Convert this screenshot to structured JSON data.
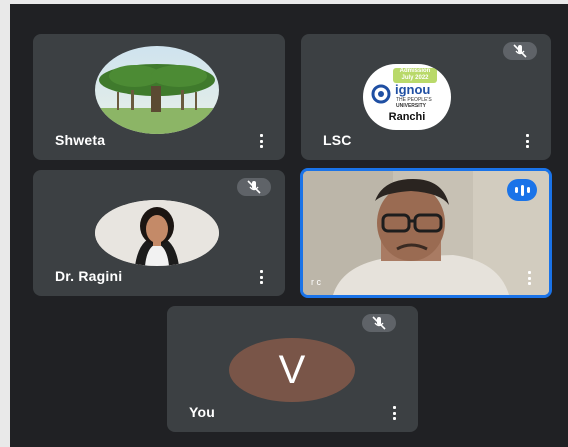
{
  "participants": [
    {
      "name": "Shweta",
      "muted": false,
      "speaking": false,
      "avatar": "tree-photo"
    },
    {
      "name": "LSC",
      "muted": true,
      "speaking": false,
      "avatar": "ignou-logo",
      "logo": {
        "admission": "Admission",
        "session": "July 2022",
        "brand": "ignou",
        "tagline1": "THE PEOPLE'S",
        "tagline2": "UNIVERSITY",
        "city": "Ranchi"
      }
    },
    {
      "name": "Dr. Ragini",
      "muted": true,
      "speaking": false,
      "avatar": "portrait-photo"
    },
    {
      "name": "",
      "muted": false,
      "speaking": true,
      "avatar": "camera-video",
      "corner_initials": "r c"
    },
    {
      "name": "You",
      "muted": true,
      "speaking": false,
      "avatar": "letter",
      "initial": "V"
    }
  ],
  "colors": {
    "tile_bg": "#3c4043",
    "page_bg": "#202124",
    "active_border": "#1a73e8",
    "self_avatar": "#795548"
  }
}
